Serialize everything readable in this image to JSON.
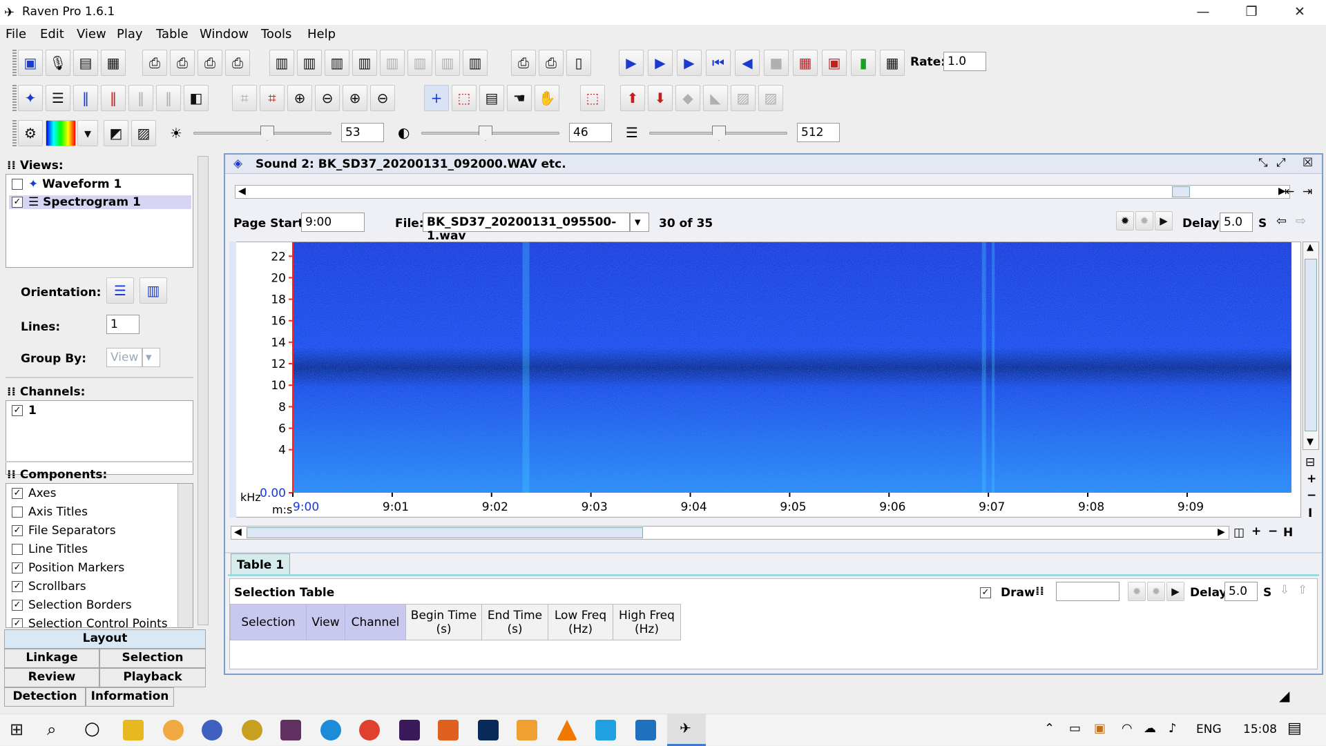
{
  "app": {
    "title": "Raven Pro 1.6.1"
  },
  "menus": [
    "File",
    "Edit",
    "View",
    "Play",
    "Table",
    "Window",
    "Tools",
    "Help"
  ],
  "toolbar": {
    "rate_label": "Rate:",
    "rate_value": "1.0",
    "brightness": "53",
    "contrast": "46",
    "resolution": "512"
  },
  "brightness_level": 53,
  "contrast_level": 46,
  "resolution_level": 50,
  "views": {
    "header": "Views:",
    "items": [
      {
        "label": "Waveform 1",
        "checked": false
      },
      {
        "label": "Spectrogram 1",
        "checked": true
      }
    ]
  },
  "layout": {
    "orientation_label": "Orientation:",
    "lines_label": "Lines:",
    "lines_value": "1",
    "groupby_label": "Group By:",
    "groupby_value": "View"
  },
  "channels": {
    "header": "Channels:",
    "items": [
      {
        "label": "1",
        "checked": true
      }
    ]
  },
  "components": {
    "header": "Components:",
    "items": [
      {
        "label": "Axes",
        "checked": true
      },
      {
        "label": "Axis Titles",
        "checked": false
      },
      {
        "label": "File Separators",
        "checked": true
      },
      {
        "label": "Line Titles",
        "checked": false
      },
      {
        "label": "Position Markers",
        "checked": true
      },
      {
        "label": "Scrollbars",
        "checked": true
      },
      {
        "label": "Selection Borders",
        "checked": true
      },
      {
        "label": "Selection Control Points",
        "checked": true
      }
    ]
  },
  "side_tabs": [
    "Layout",
    "Linkage",
    "Selection",
    "Review",
    "Playback",
    "Detection",
    "Information"
  ],
  "sound": {
    "title": "Sound 2: BK_SD37_20200131_092000.WAV etc.",
    "page_start_label": "Page Start:",
    "page_start": "9:00",
    "file_label": "File:",
    "file_value": "BK_SD37_20200131_095500-1.wav",
    "file_index": "30 of 35",
    "delay_label": "Delay:",
    "delay_value": "5.0",
    "delay_unit": "S"
  },
  "axes": {
    "y_unit": "kHz",
    "x_unit": "m:s",
    "y_ticks": [
      "22",
      "20",
      "18",
      "16",
      "14",
      "12",
      "10",
      "8",
      "6",
      "4",
      "0.00"
    ],
    "x_ticks": [
      "9:00",
      "9:01",
      "9:02",
      "9:03",
      "9:04",
      "9:05",
      "9:06",
      "9:07",
      "9:08",
      "9:09"
    ]
  },
  "table": {
    "tab_label": "Table 1",
    "title": "Selection Table",
    "draw_label": "Draw",
    "delay_label": "Delay:",
    "delay_value": "5.0",
    "delay_unit": "S",
    "columns": [
      "Selection",
      "View",
      "Channel",
      "Begin Time (s)",
      "End Time (s)",
      "Low Freq (Hz)",
      "High Freq (Hz)"
    ]
  },
  "taskbar": {
    "lang": "ENG",
    "time": "15:08"
  },
  "colors": {
    "accent": "#7b9dc9",
    "spec_dark": "#0a1a8a",
    "spec_mid": "#1e4de0",
    "spec_light": "#32b0ff"
  }
}
